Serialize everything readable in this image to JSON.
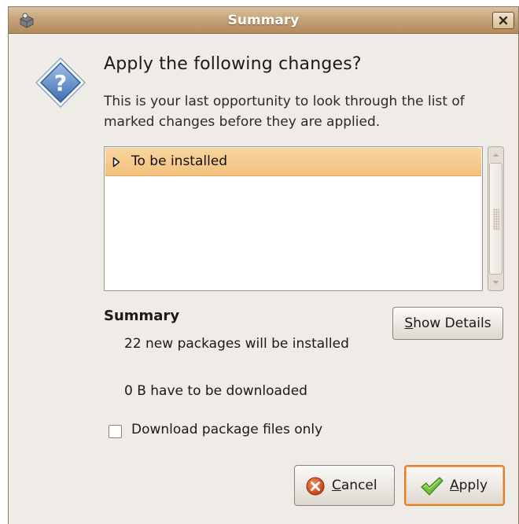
{
  "window": {
    "title": "Summary"
  },
  "dialog": {
    "icon": "question-diamond-icon",
    "heading": "Apply the following changes?",
    "description": "This is your last opportunity to look through the list of marked changes before they are applied."
  },
  "changes_list": {
    "rows": [
      {
        "label": "To be installed",
        "expanded": false,
        "selected": true
      }
    ]
  },
  "summary": {
    "label": "Summary",
    "packages_line": "22 new packages will be installed",
    "download_line": "0  B have to be downloaded"
  },
  "buttons": {
    "show_details": {
      "mnemonic": "S",
      "rest": "how Details"
    },
    "cancel": {
      "mnemonic": "C",
      "rest": "ancel",
      "icon": "cancel-icon"
    },
    "apply": {
      "mnemonic": "A",
      "rest": "pply",
      "icon": "checkmark-icon"
    }
  },
  "options": {
    "download_only_label": "Download package files only",
    "download_only_checked": false
  },
  "colors": {
    "titlebar": "#c6a47a",
    "selection": "#f3c07d",
    "apply_focus": "#e27f2c",
    "dialog_bg": "#efebe7"
  }
}
